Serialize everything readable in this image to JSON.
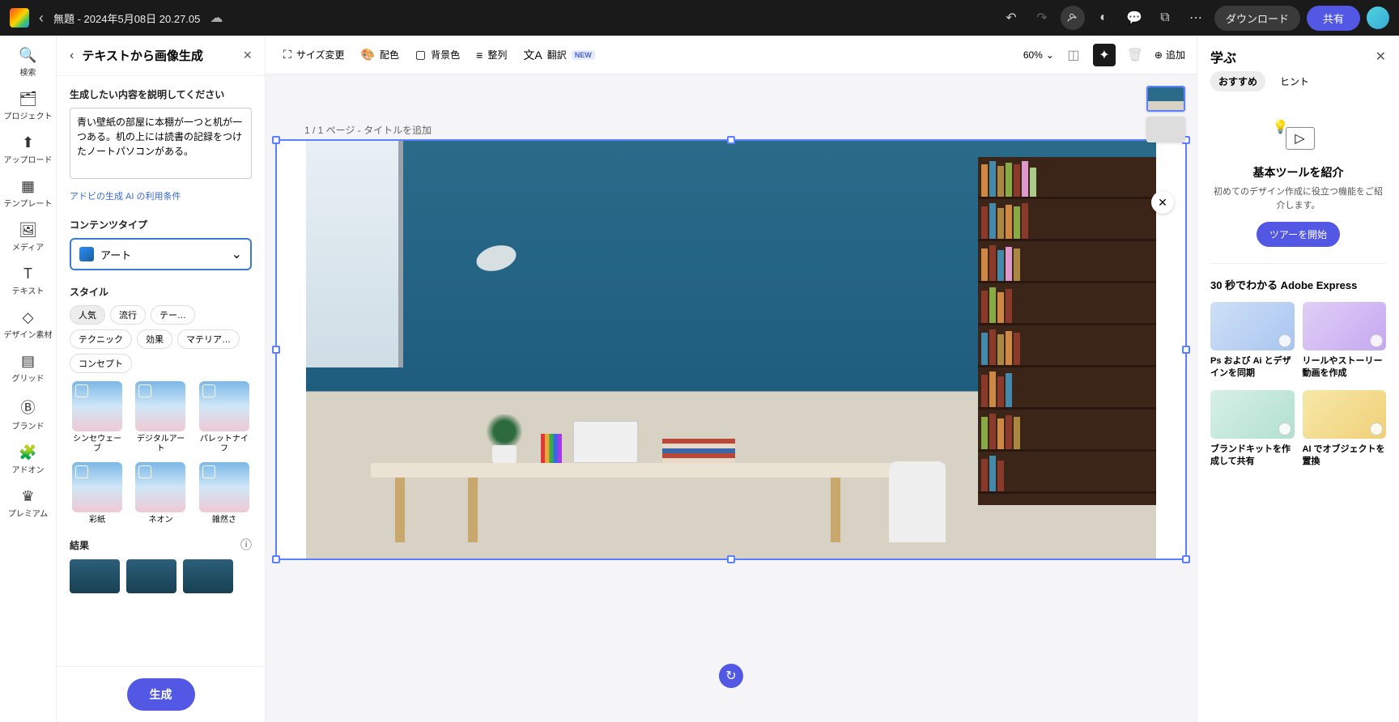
{
  "header": {
    "doc_title": "無題 - 2024年5月08日 20.27.05",
    "download": "ダウンロード",
    "share": "共有"
  },
  "rail": {
    "search": "検索",
    "project": "プロジェクト",
    "upload": "アップロード",
    "template": "テンプレート",
    "media": "メディア",
    "text": "テキスト",
    "shapes": "デザイン素材",
    "grid": "グリッド",
    "brand": "ブランド",
    "addon": "アドオン",
    "premium": "プレミアム"
  },
  "panel": {
    "title": "テキストから画像生成",
    "prompt_label": "生成したい内容を説明してください",
    "prompt_value": "青い壁紙の部屋に本棚が一つと机が一つある。机の上には読書の記録をつけたノートパソコンがある。",
    "terms_link": "アドビの生成 AI の利用条件",
    "content_type_label": "コンテンツタイプ",
    "content_type_value": "アート",
    "style_label": "スタイル",
    "chips": [
      "人気",
      "流行",
      "テー…",
      "テクニック",
      "効果",
      "マテリア…",
      "コンセプト"
    ],
    "chip_active_index": 0,
    "styles": [
      "シンセウェーブ",
      "デジタルアート",
      "パレットナイフ",
      "彩紙",
      "ネオン",
      "雑然さ"
    ],
    "results_label": "結果",
    "generate": "生成"
  },
  "toolbar": {
    "resize": "サイズ変更",
    "colors": "配色",
    "bgcolor": "背景色",
    "align": "整列",
    "translate": "翻訳",
    "new_badge": "NEW",
    "zoom": "60%",
    "add": "追加"
  },
  "canvas": {
    "page_label": "1 / 1 ページ - タイトルを追加"
  },
  "learn": {
    "title": "学ぶ",
    "tab_recommended": "おすすめ",
    "tab_hints": "ヒント",
    "intro_title": "基本ツールを紹介",
    "intro_desc": "初めてのデザイン作成に役立つ機能をご紹介します。",
    "tour_btn": "ツアーを開始",
    "section_title": "30 秒でわかる Adobe Express",
    "tutorials": [
      "Ps および Ai とデザインを同期",
      "リールやストーリー動画を作成",
      "ブランドキットを作成して共有",
      "AI でオブジェクトを置換"
    ]
  }
}
